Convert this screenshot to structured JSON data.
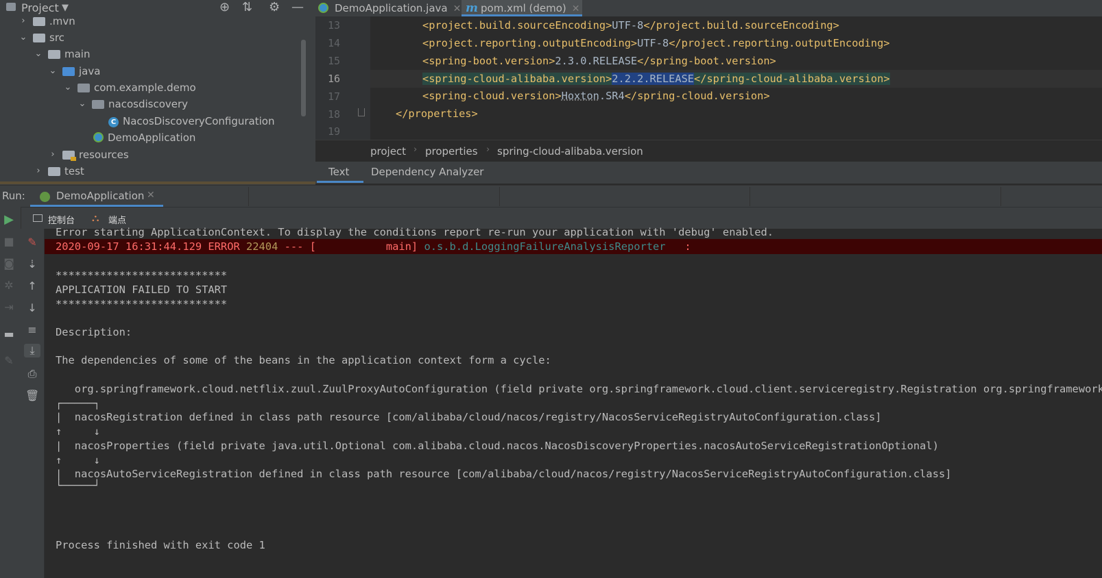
{
  "project_panel": {
    "title": "Project",
    "tree": [
      {
        "label": ".mvn"
      },
      {
        "label": "src"
      },
      {
        "label": "main"
      },
      {
        "label": "java"
      },
      {
        "label": "com.example.demo"
      },
      {
        "label": "nacosdiscovery"
      },
      {
        "label": "NacosDiscoveryConfiguration"
      },
      {
        "label": "DemoApplication"
      },
      {
        "label": "resources"
      },
      {
        "label": "test"
      }
    ]
  },
  "editor": {
    "tabs": [
      {
        "label": "DemoApplication.java"
      },
      {
        "label": "pom.xml (demo)"
      }
    ],
    "line_numbers": [
      "13",
      "14",
      "15",
      "16",
      "17",
      "18",
      "19"
    ],
    "lines": {
      "l13": {
        "open": "<project.build.sourceEncoding>",
        "value": "UTF-8",
        "close": "</project.build.sourceEncoding>"
      },
      "l14": {
        "open": "<project.reporting.outputEncoding>",
        "value": "UTF-8",
        "close": "</project.reporting.outputEncoding>"
      },
      "l15": {
        "open": "<spring-boot.version>",
        "value": "2.3.0.RELEASE",
        "close": "</spring-boot.version>"
      },
      "l16": {
        "open": "<spring-cloud-alibaba.version>",
        "value": "2.2.2.RELEASE",
        "close": "</spring-cloud-alibaba.version>"
      },
      "l17": {
        "open": "<spring-cloud.version>",
        "value_a": "Hoxton",
        "value_b": ".SR4",
        "close": "</spring-cloud.version>"
      },
      "l18": {
        "close": "</properties>"
      }
    },
    "breadcrumb": [
      "project",
      "properties",
      "spring-cloud-alibaba.version"
    ],
    "bottom_tabs": [
      "Text",
      "Dependency Analyzer"
    ]
  },
  "run_panel": {
    "label": "Run:",
    "tab": "DemoApplication",
    "sub_tabs": [
      "控制台",
      "端点"
    ],
    "console": {
      "line_partial": "Error starting ApplicationContext. To display the conditions report re-run your application with 'debug' enabled.",
      "error_line": {
        "timestamp": "2020-09-17 16:31:44.129 ",
        "level": "ERROR",
        "pid": " 22404",
        "rest": " --- [           main] ",
        "logger": "o.s.b.d.LoggingFailureAnalysisReporter",
        "tail": "   :"
      },
      "stars": "***************************",
      "failed": "APPLICATION FAILED TO START",
      "description": "Description:",
      "cycle_intro": "The dependencies of some of the beans in the application context form a cycle:",
      "zuul_line": "   org.springframework.cloud.netflix.zuul.ZuulProxyAutoConfiguration (field private org.springframework.cloud.client.serviceregistry.Registration org.springframework.cloud",
      "box_top": "┌─────┐",
      "cycle_1": "|  nacosRegistration defined in class path resource [com/alibaba/cloud/nacos/registry/NacosServiceRegistryAutoConfiguration.class]",
      "arrows_1": "↑     ↓",
      "cycle_2": "|  nacosProperties (field private java.util.Optional com.alibaba.cloud.nacos.NacosDiscoveryProperties.nacosAutoServiceRegistrationOptional)",
      "arrows_2": "↑     ↓",
      "cycle_3": "|  nacosAutoServiceRegistration defined in class path resource [com/alibaba/cloud/nacos/registry/NacosServiceRegistryAutoConfiguration.class]",
      "box_bottom": "└─────┘",
      "exit": "Process finished with exit code 1"
    }
  },
  "colors": {
    "background": "#2b2b2b",
    "panel": "#3c3f41",
    "tag": "#e8bf6a",
    "error_red": "#ff6b68",
    "accent_blue": "#4a88c7"
  }
}
